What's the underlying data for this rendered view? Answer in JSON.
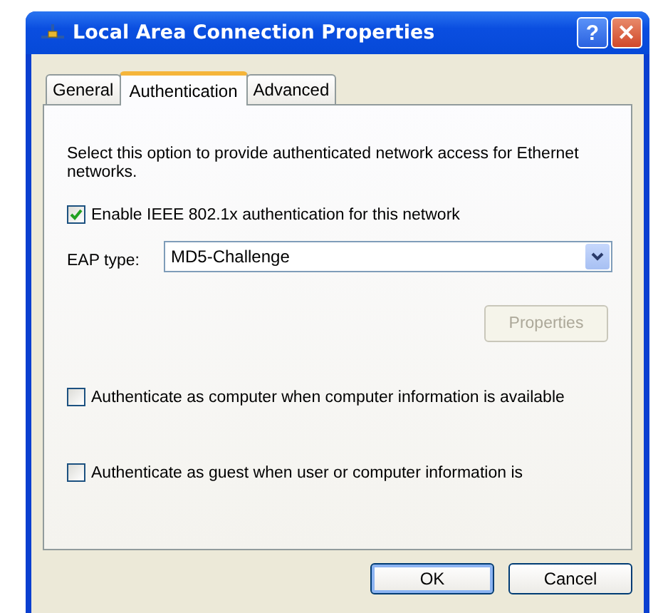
{
  "window": {
    "title": "Local Area Connection Properties"
  },
  "title_buttons": [
    {
      "kind": "help",
      "label": "?"
    },
    {
      "kind": "close",
      "label": "✕"
    }
  ],
  "tabs": [
    {
      "label": "General",
      "selected": false
    },
    {
      "label": "Authentication",
      "selected": true
    },
    {
      "label": "Advanced",
      "selected": false
    }
  ],
  "description": "Select this option to provide authenticated network access for Ethernet networks.",
  "enable_checkbox": {
    "label": "Enable IEEE 802.1x authentication for this network",
    "checked": true
  },
  "eap_type": {
    "label": "EAP type:",
    "value": "MD5-Challenge"
  },
  "properties_button": {
    "label": "Properties",
    "disabled": true
  },
  "options": [
    {
      "label": "Authenticate as computer when computer information is available",
      "checked": false
    },
    {
      "label": "Authenticate as guest when user or computer information is",
      "checked": false
    }
  ],
  "buttons": [
    {
      "label": "OK",
      "default": true
    },
    {
      "label": "Cancel",
      "default": false
    }
  ]
}
